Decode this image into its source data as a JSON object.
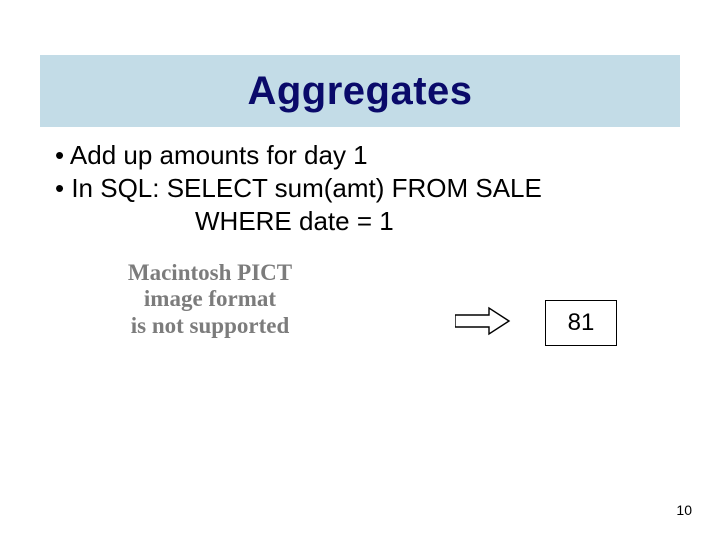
{
  "title": "Aggregates",
  "bullets": {
    "b1": "• Add up amounts for day 1",
    "b2": "• In SQL:  SELECT sum(amt) FROM SALE",
    "b2_cont": "WHERE date = 1"
  },
  "pict_placeholder": {
    "line1": "Macintosh PICT",
    "line2": "image format",
    "line3": "is not supported"
  },
  "result_value": "81",
  "page_number": "10"
}
